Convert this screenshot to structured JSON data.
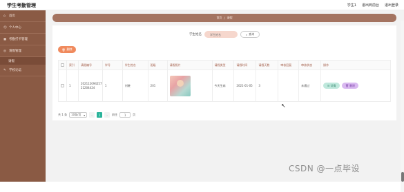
{
  "header": {
    "title": "学生考勤管理",
    "links": [
      "学生1",
      "退出到前台",
      "退出登录"
    ]
  },
  "sidebar": {
    "items": [
      {
        "icon": "home-icon",
        "label": "首页"
      },
      {
        "icon": "user-icon",
        "label": "个人中心"
      },
      {
        "icon": "calendar-icon",
        "label": "考勤打卡管理"
      },
      {
        "icon": "leave-icon",
        "label": "请假管理"
      }
    ],
    "sub_items": [
      {
        "label": "请假"
      }
    ],
    "extra_items": [
      {
        "icon": "forum-icon",
        "label": "学校论坛"
      }
    ]
  },
  "breadcrumb": {
    "home": "首页",
    "separator": "/",
    "current": "请假"
  },
  "search": {
    "label": "学生姓名",
    "placeholder": "学生姓名",
    "query_button": "查询"
  },
  "toolbar": {
    "delete_label": "删除"
  },
  "table": {
    "columns": [
      "索引",
      "请假编号",
      "学号",
      "学生姓名",
      "班级",
      "请假照片",
      "请假类型",
      "请假时间",
      "请假天数",
      "审核回复",
      "审核状态",
      "操作"
    ],
    "rows": [
      {
        "index": "1",
        "leave_no": "20211209425721204424",
        "student_no": "1",
        "name": "刘晓",
        "class": "201",
        "type": "今天生病",
        "date": "2021-01-05",
        "days": "3",
        "reply": "",
        "status": "未通过",
        "detail_label": "详情",
        "delete_label": "删除"
      }
    ]
  },
  "pagination": {
    "total": "共 1 条",
    "page_size": "10条/页",
    "current_page": "1",
    "goto_label": "前往",
    "goto_value": "1",
    "page_suffix": "页"
  },
  "watermark": "CSDN @一点毕设",
  "colors": {
    "sidebar": "#8a5a44",
    "breadcrumb": "#a47461",
    "accent_orange": "#f08a5d",
    "accent_green": "#2ab39a"
  }
}
